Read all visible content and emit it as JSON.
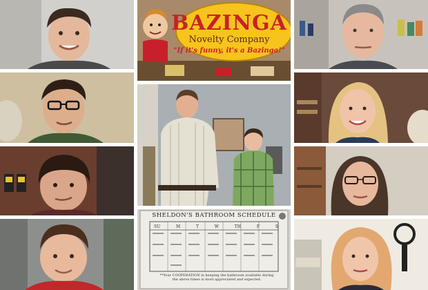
{
  "collage": {
    "tiles": [
      {
        "id": "young-man-smiling",
        "palette": [
          "#cfcfcf",
          "#7a6a5a"
        ]
      },
      {
        "id": "man-with-glasses",
        "palette": [
          "#c9b99a",
          "#3a5a3a"
        ]
      },
      {
        "id": "man-bowl-haircut",
        "palette": [
          "#6a3b2c",
          "#3a2b24"
        ]
      },
      {
        "id": "boy-red-shirt",
        "palette": [
          "#8a8a8a",
          "#b02020"
        ]
      },
      {
        "id": "bazinga-sign",
        "palette": [
          "#f4c21a",
          "#c8202a"
        ]
      },
      {
        "id": "father-and-boy",
        "palette": [
          "#9aa1a6",
          "#e6e2d6"
        ]
      },
      {
        "id": "bathroom-schedule",
        "palette": [
          "#eae8e2",
          "#222222"
        ]
      },
      {
        "id": "older-man",
        "palette": [
          "#c9c4bd",
          "#6a6a6a"
        ]
      },
      {
        "id": "blonde-woman-smiling",
        "palette": [
          "#6a4a3a",
          "#e8c88a"
        ]
      },
      {
        "id": "woman-with-glasses",
        "palette": [
          "#d6d0c6",
          "#4a3a30"
        ]
      },
      {
        "id": "blonde-woman-curly",
        "palette": [
          "#f0ece4",
          "#e0a870"
        ]
      }
    ]
  },
  "bazinga": {
    "title": "BAZINGA",
    "subtitle": "Novelty Company",
    "tagline": "\"If it's funny, it's a Bazinga!\""
  },
  "schedule": {
    "title": "SHELDON'S BATHROOM SCHEDULE",
    "days": [
      "SU",
      "M",
      "T",
      "W",
      "TH",
      "F",
      "S"
    ],
    "note": "**Your COOPERATION in keeping the bathroom available during the above times is most appreciated and expected."
  }
}
